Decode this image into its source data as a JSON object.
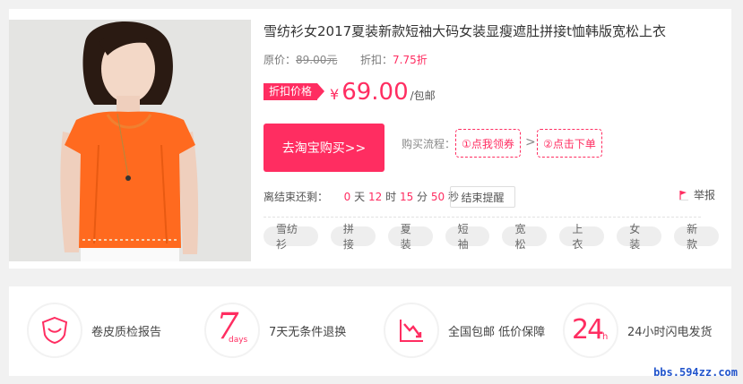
{
  "product": {
    "title": "雪纺衫女2017夏装新款短袖大码女装显瘦遮肚拼接t恤韩版宽松上衣",
    "original_price_label": "原价：",
    "original_price": "89.00元",
    "discount_label": "折扣：",
    "discount_value": "7.75折",
    "deal_tag": "折扣价格",
    "currency": "¥",
    "price": "69.00",
    "shipping": "/包邮",
    "image_icon": "model-photo"
  },
  "purchase": {
    "buy_button": "去淘宝购买>>",
    "flow_label": "购买流程：",
    "step1": "①点我领券",
    "step_arrow": ">",
    "step2": "②点击下单"
  },
  "countdown": {
    "label": "离结束还剩：",
    "days": "0",
    "days_unit": "天",
    "hours": "12",
    "hours_unit": "时",
    "minutes": "15",
    "minutes_unit": "分",
    "seconds": "50",
    "seconds_unit": "秒",
    "remind_button": "结束提醒",
    "report_label": "举报",
    "report_icon": "flag-icon"
  },
  "tags": [
    "雪纺衫",
    "拼接",
    "夏装",
    "短袖",
    "宽松",
    "上衣",
    "女装",
    "新款"
  ],
  "services": [
    {
      "icon": "shield-icon",
      "label": "卷皮质检报告"
    },
    {
      "icon": "seven-days-icon",
      "label": "7天无条件退换",
      "icon_text": "7",
      "icon_sub": "days"
    },
    {
      "icon": "price-down-icon",
      "label": "全国包邮 低价保障"
    },
    {
      "icon": "24h-icon",
      "label": "24小时闪电发货",
      "icon_text": "24",
      "icon_sub": "h"
    }
  ],
  "watermark": "bbs.594zz.com",
  "colors": {
    "accent": "#ff2d61",
    "background": "#f1f1f1"
  }
}
